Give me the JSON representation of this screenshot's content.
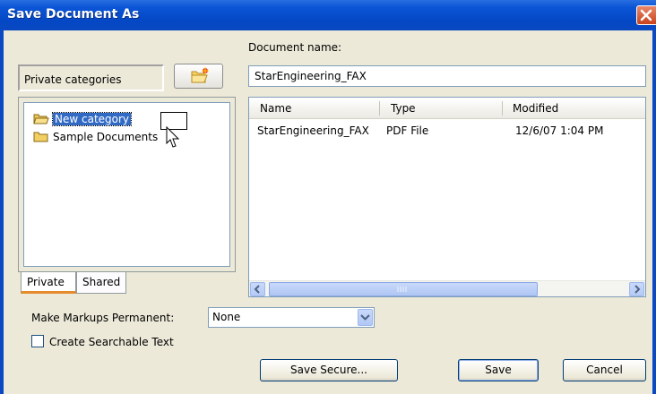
{
  "window": {
    "title": "Save Document As"
  },
  "document_name": {
    "label": "Document name:",
    "value": "StarEngineering_FAX"
  },
  "categories": {
    "selector_label": "Private categories",
    "tree": [
      {
        "label": "New category",
        "icon": "folder-open-icon",
        "selected": true
      },
      {
        "label": "Sample Documents",
        "icon": "folder-icon",
        "selected": false
      }
    ],
    "tabs": [
      {
        "label": "Private",
        "active": true
      },
      {
        "label": "Shared",
        "active": false
      }
    ]
  },
  "file_list": {
    "columns": [
      "Name",
      "Type",
      "Modified"
    ],
    "rows": [
      {
        "name": "StarEngineering_FAX",
        "type": "PDF File",
        "modified": "12/6/07 1:04 PM"
      }
    ]
  },
  "markups": {
    "label": "Make Markups Permanent:",
    "selected": "None"
  },
  "searchable": {
    "label": "Create Searchable Text",
    "checked": false
  },
  "buttons": {
    "save_secure": "Save Secure...",
    "save": "Save",
    "cancel": "Cancel"
  }
}
